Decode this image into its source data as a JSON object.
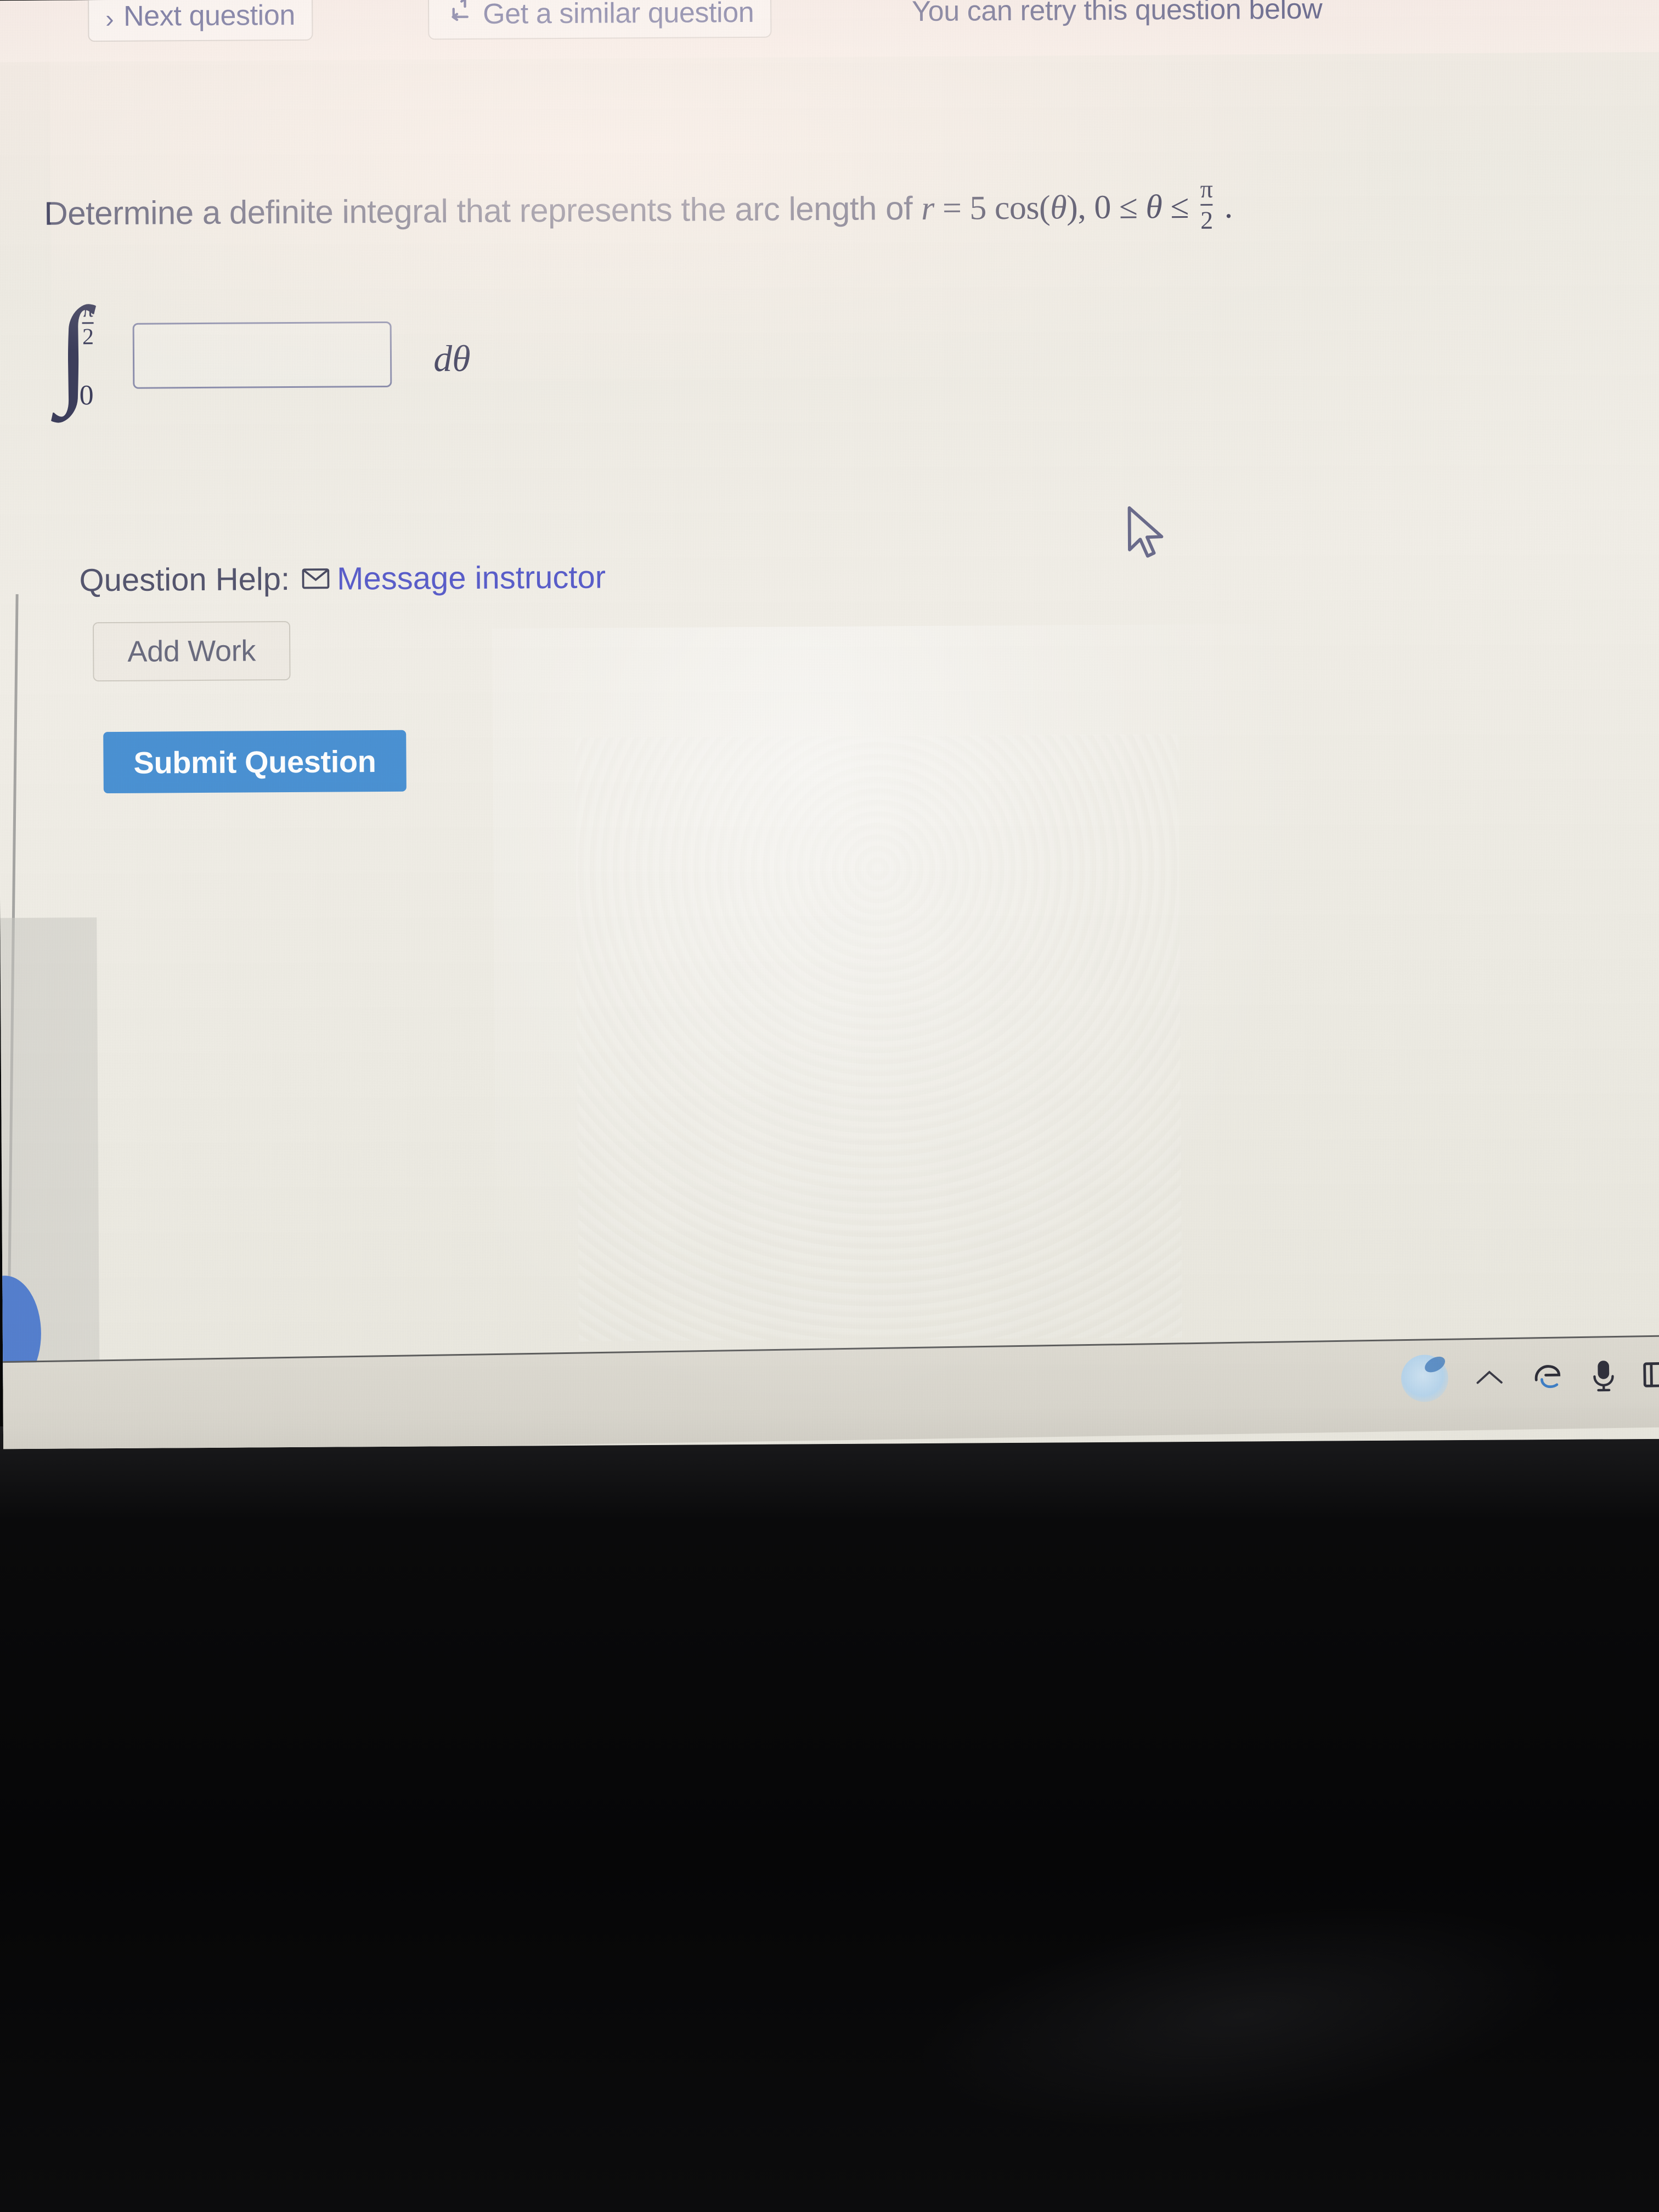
{
  "toolbar": {
    "next_question_label": "Next question",
    "next_question_icon": "chevron-right-icon",
    "similar_question_label": "Get a similar question",
    "similar_question_icon": "refresh-cycle-icon",
    "retry_notice": "You can retry this question below"
  },
  "question": {
    "prompt_prefix": "Determine a definite integral that represents the arc length of",
    "equation_variable": "r",
    "equation_equals": "=",
    "equation_rhs": "5 cos(",
    "equation_theta": "θ",
    "equation_rhs_close": "),",
    "domain_lower": "0",
    "domain_rel1": "≤",
    "domain_var": "θ",
    "domain_rel2": "≤",
    "domain_upper_num": "π",
    "domain_upper_den": "2",
    "period": "."
  },
  "integral": {
    "sign": "∫",
    "upper_limit_num": "π",
    "upper_limit_den": "2",
    "lower_limit": "0",
    "answer_value": "",
    "answer_placeholder": "",
    "differential": "dθ"
  },
  "help": {
    "label": "Question Help:",
    "message_instructor_label": "Message instructor",
    "message_instructor_icon": "envelope-icon",
    "add_work_label": "Add Work"
  },
  "actions": {
    "submit_label": "Submit Question",
    "submit_color": "#4b92d4"
  },
  "taskbar": {
    "tray_icons": [
      "cortana-glow-icon",
      "chevron-up-icon",
      "edge-browser-icon",
      "microphone-icon",
      "notification-box-icon"
    ]
  },
  "colors": {
    "page_background": "#f1ede5",
    "toolbar_background": "#f7ece7",
    "link_blue": "#5a5ecb",
    "text_purple_gray": "#6e6f9b",
    "accent_blue": "#4b92d4",
    "bubble_blue": "#5580cf"
  }
}
